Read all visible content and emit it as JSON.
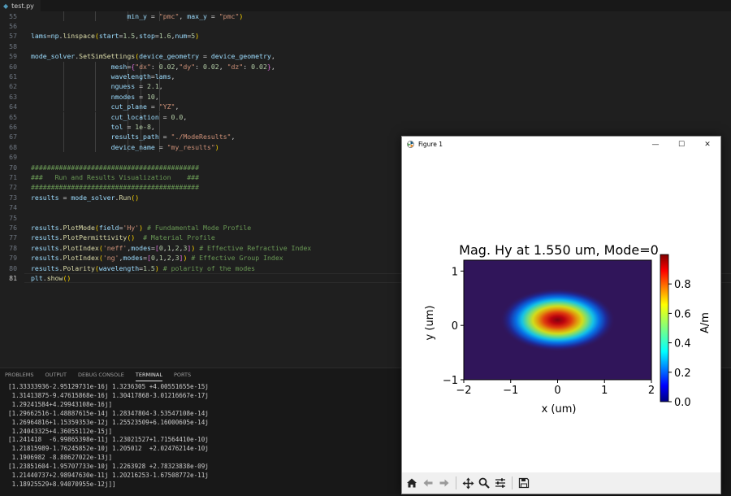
{
  "tab": {
    "filename": "test.py",
    "icon": "python-file-icon"
  },
  "editor": {
    "current_line": 81,
    "lines": [
      {
        "n": 55,
        "guides": 4,
        "tokens": [
          [
            "                        ",
            "op"
          ],
          [
            "min_y",
            "id"
          ],
          [
            " = ",
            "op"
          ],
          [
            "\"pmc\"",
            "str"
          ],
          [
            ", ",
            "op"
          ],
          [
            "max_y",
            "id"
          ],
          [
            " = ",
            "op"
          ],
          [
            "\"pmc\"",
            "str"
          ],
          [
            ")",
            "br1"
          ]
        ]
      },
      {
        "n": 56,
        "guides": 0,
        "tokens": []
      },
      {
        "n": 57,
        "guides": 0,
        "tokens": [
          [
            "lams",
            "id"
          ],
          [
            "=",
            "op"
          ],
          [
            "np",
            "id"
          ],
          [
            ".",
            "op"
          ],
          [
            "linspace",
            "fn"
          ],
          [
            "(",
            "br1"
          ],
          [
            "start",
            "id"
          ],
          [
            "=",
            "op"
          ],
          [
            "1.5",
            "num"
          ],
          [
            ",",
            "op"
          ],
          [
            "stop",
            "id"
          ],
          [
            "=",
            "op"
          ],
          [
            "1.6",
            "num"
          ],
          [
            ",",
            "op"
          ],
          [
            "num",
            "id"
          ],
          [
            "=",
            "op"
          ],
          [
            "5",
            "num"
          ],
          [
            ")",
            "br1"
          ]
        ]
      },
      {
        "n": 58,
        "guides": 0,
        "tokens": []
      },
      {
        "n": 59,
        "guides": 0,
        "tokens": [
          [
            "mode_solver",
            "id"
          ],
          [
            ".",
            "op"
          ],
          [
            "SetSimSettings",
            "fn"
          ],
          [
            "(",
            "br1"
          ],
          [
            "device_geometry",
            "id"
          ],
          [
            " = ",
            "op"
          ],
          [
            "device_geometry",
            "id"
          ],
          [
            ",",
            "op"
          ]
        ]
      },
      {
        "n": 60,
        "guides": 5,
        "tokens": [
          [
            "                    ",
            "op"
          ],
          [
            "mesh",
            "id"
          ],
          [
            "=",
            "op"
          ],
          [
            "{",
            "br2"
          ],
          [
            "\"dx\"",
            "str"
          ],
          [
            ": ",
            "op"
          ],
          [
            "0.02",
            "num"
          ],
          [
            ",",
            "op"
          ],
          [
            "\"dy\"",
            "str"
          ],
          [
            ": ",
            "op"
          ],
          [
            "0.02",
            "num"
          ],
          [
            ", ",
            "op"
          ],
          [
            "\"dz\"",
            "str"
          ],
          [
            ": ",
            "op"
          ],
          [
            "0.02",
            "num"
          ],
          [
            "}",
            "br2"
          ],
          [
            ",",
            "op"
          ]
        ]
      },
      {
        "n": 61,
        "guides": 5,
        "tokens": [
          [
            "                    ",
            "op"
          ],
          [
            "wavelength",
            "id"
          ],
          [
            "=",
            "op"
          ],
          [
            "lams",
            "id"
          ],
          [
            ",",
            "op"
          ]
        ]
      },
      {
        "n": 62,
        "guides": 5,
        "tokens": [
          [
            "                    ",
            "op"
          ],
          [
            "nguess",
            "id"
          ],
          [
            " = ",
            "op"
          ],
          [
            "2.1",
            "num"
          ],
          [
            ",",
            "op"
          ]
        ]
      },
      {
        "n": 63,
        "guides": 5,
        "tokens": [
          [
            "                    ",
            "op"
          ],
          [
            "nmodes",
            "id"
          ],
          [
            " = ",
            "op"
          ],
          [
            "10",
            "num"
          ],
          [
            ",",
            "op"
          ]
        ]
      },
      {
        "n": 64,
        "guides": 5,
        "tokens": [
          [
            "                    ",
            "op"
          ],
          [
            "cut_plane",
            "id"
          ],
          [
            " = ",
            "op"
          ],
          [
            "\"YZ\"",
            "str"
          ],
          [
            ",",
            "op"
          ]
        ]
      },
      {
        "n": 65,
        "guides": 5,
        "tokens": [
          [
            "                    ",
            "op"
          ],
          [
            "cut_location",
            "id"
          ],
          [
            " = ",
            "op"
          ],
          [
            "0.0",
            "num"
          ],
          [
            ",",
            "op"
          ]
        ]
      },
      {
        "n": 66,
        "guides": 5,
        "tokens": [
          [
            "                    ",
            "op"
          ],
          [
            "tol",
            "id"
          ],
          [
            " = ",
            "op"
          ],
          [
            "1e-8",
            "num"
          ],
          [
            ",",
            "op"
          ]
        ]
      },
      {
        "n": 67,
        "guides": 5,
        "tokens": [
          [
            "                    ",
            "op"
          ],
          [
            "results_path",
            "id"
          ],
          [
            " = ",
            "op"
          ],
          [
            "\"./ModeResults\"",
            "str"
          ],
          [
            ",",
            "op"
          ]
        ]
      },
      {
        "n": 68,
        "guides": 5,
        "tokens": [
          [
            "                    ",
            "op"
          ],
          [
            "device_name",
            "id"
          ],
          [
            " = ",
            "op"
          ],
          [
            "\"my_results\"",
            "str"
          ],
          [
            ")",
            "br1"
          ]
        ]
      },
      {
        "n": 69,
        "guides": 0,
        "tokens": []
      },
      {
        "n": 70,
        "guides": 0,
        "tokens": [
          [
            "##########################################",
            "cm"
          ]
        ]
      },
      {
        "n": 71,
        "guides": 0,
        "tokens": [
          [
            "###   Run and Results Visualization    ###",
            "cm"
          ]
        ]
      },
      {
        "n": 72,
        "guides": 0,
        "tokens": [
          [
            "##########################################",
            "cm"
          ]
        ]
      },
      {
        "n": 73,
        "guides": 0,
        "tokens": [
          [
            "results",
            "id"
          ],
          [
            " = ",
            "op"
          ],
          [
            "mode_solver",
            "id"
          ],
          [
            ".",
            "op"
          ],
          [
            "Run",
            "fn"
          ],
          [
            "(",
            "br1"
          ],
          [
            ")",
            "br1"
          ]
        ]
      },
      {
        "n": 74,
        "guides": 0,
        "tokens": []
      },
      {
        "n": 75,
        "guides": 0,
        "tokens": []
      },
      {
        "n": 76,
        "guides": 0,
        "tokens": [
          [
            "results",
            "id"
          ],
          [
            ".",
            "op"
          ],
          [
            "PlotMode",
            "fn"
          ],
          [
            "(",
            "br1"
          ],
          [
            "field",
            "id"
          ],
          [
            "=",
            "op"
          ],
          [
            "'Hy'",
            "str"
          ],
          [
            ")",
            "br1"
          ],
          [
            " ",
            "op"
          ],
          [
            "# Fundamental Mode Profile",
            "cm"
          ]
        ]
      },
      {
        "n": 77,
        "guides": 0,
        "tokens": [
          [
            "results",
            "id"
          ],
          [
            ".",
            "op"
          ],
          [
            "PlotPermittivity",
            "fn"
          ],
          [
            "(",
            "br1"
          ],
          [
            ")",
            "br1"
          ],
          [
            "  ",
            "op"
          ],
          [
            "# Material Profile",
            "cm"
          ]
        ]
      },
      {
        "n": 78,
        "guides": 0,
        "tokens": [
          [
            "results",
            "id"
          ],
          [
            ".",
            "op"
          ],
          [
            "PlotIndex",
            "fn"
          ],
          [
            "(",
            "br1"
          ],
          [
            "'neff'",
            "str"
          ],
          [
            ",",
            "op"
          ],
          [
            "modes",
            "id"
          ],
          [
            "=",
            "op"
          ],
          [
            "[",
            "br2"
          ],
          [
            "0",
            "num"
          ],
          [
            ",",
            "op"
          ],
          [
            "1",
            "num"
          ],
          [
            ",",
            "op"
          ],
          [
            "2",
            "num"
          ],
          [
            ",",
            "op"
          ],
          [
            "3",
            "num"
          ],
          [
            "]",
            "br2"
          ],
          [
            ")",
            "br1"
          ],
          [
            " ",
            "op"
          ],
          [
            "# Effective Refractive Index",
            "cm"
          ]
        ]
      },
      {
        "n": 79,
        "guides": 0,
        "tokens": [
          [
            "results",
            "id"
          ],
          [
            ".",
            "op"
          ],
          [
            "PlotIndex",
            "fn"
          ],
          [
            "(",
            "br1"
          ],
          [
            "'ng'",
            "str"
          ],
          [
            ",",
            "op"
          ],
          [
            "modes",
            "id"
          ],
          [
            "=",
            "op"
          ],
          [
            "[",
            "br2"
          ],
          [
            "0",
            "num"
          ],
          [
            ",",
            "op"
          ],
          [
            "1",
            "num"
          ],
          [
            ",",
            "op"
          ],
          [
            "2",
            "num"
          ],
          [
            ",",
            "op"
          ],
          [
            "3",
            "num"
          ],
          [
            "]",
            "br2"
          ],
          [
            ")",
            "br1"
          ],
          [
            " ",
            "op"
          ],
          [
            "# Effective Group Index",
            "cm"
          ]
        ]
      },
      {
        "n": 80,
        "guides": 0,
        "tokens": [
          [
            "results",
            "id"
          ],
          [
            ".",
            "op"
          ],
          [
            "Polarity",
            "fn"
          ],
          [
            "(",
            "br1"
          ],
          [
            "wavelength",
            "id"
          ],
          [
            "=",
            "op"
          ],
          [
            "1.5",
            "num"
          ],
          [
            ")",
            "br1"
          ],
          [
            " ",
            "op"
          ],
          [
            "# polarity of the modes",
            "cm"
          ]
        ]
      },
      {
        "n": 81,
        "guides": 0,
        "tokens": [
          [
            "plt",
            "id"
          ],
          [
            ".",
            "op"
          ],
          [
            "show",
            "fn"
          ],
          [
            "(",
            "br1"
          ],
          [
            ")",
            "br1"
          ]
        ]
      }
    ]
  },
  "panel": {
    "tabs": [
      "PROBLEMS",
      "OUTPUT",
      "DEBUG CONSOLE",
      "TERMINAL",
      "PORTS"
    ],
    "active_tab": "TERMINAL",
    "terminal_lines": [
      "[1.33333936-2.95129731e-16j 1.3236305 +4.00551655e-15j",
      " 1.31413875-9.47615868e-16j 1.30417868-3.01216667e-17j",
      " 1.29241584+4.29943108e-16j]",
      "[1.29662516-1.48887615e-14j 1.28347804-3.53547108e-14j",
      " 1.26964816+1.15359353e-12j 1.25523509+6.16000605e-14j",
      " 1.24043325+4.36055112e-15j]",
      "[1.241418  -6.99865398e-11j 1.23021527+1.71564410e-10j",
      " 1.21815989-1.76245852e-10j 1.205012  +2.02476214e-10j",
      " 1.1906982 -8.88627022e-13j]",
      "[1.23851604-1.95707733e-10j 1.2263928 +2.78323838e-09j",
      " 1.21440737+2.98947630e-11j 1.20216253-1.67508772e-11j",
      " 1.18925529+8.94070955e-12j]]"
    ]
  },
  "figure": {
    "window_title": "Figure 1",
    "app_icon": "matplotlib-icon",
    "buttons": {
      "minimize": "—",
      "maximize": "☐",
      "close": "✕"
    },
    "toolbar": [
      "home-icon",
      "back-arrow-icon",
      "forward-arrow-icon",
      "pan-icon",
      "zoom-icon",
      "configure-subplots-icon",
      "save-icon"
    ]
  },
  "chart_data": {
    "type": "heatmap",
    "title": "Mag. Hy at 1.550 um, Mode=0",
    "xlabel": "x (um)",
    "ylabel": "y (um)",
    "xlim": [
      -2,
      2
    ],
    "ylim": [
      -1,
      1.2
    ],
    "xticks": [
      "−2",
      "−1",
      "0",
      "1",
      "2"
    ],
    "yticks": [
      "−1",
      "0",
      "1"
    ],
    "colorbar_label": "A/m",
    "colorbar_range": [
      0,
      1
    ],
    "colorbar_ticks": [
      "0.0",
      "0.2",
      "0.4",
      "0.6",
      "0.8"
    ],
    "colormap": "jet",
    "peak": {
      "x": 0,
      "y": 0.1,
      "value": 1.0
    },
    "mode_width_x": 0.45,
    "mode_width_y": 0.18
  }
}
